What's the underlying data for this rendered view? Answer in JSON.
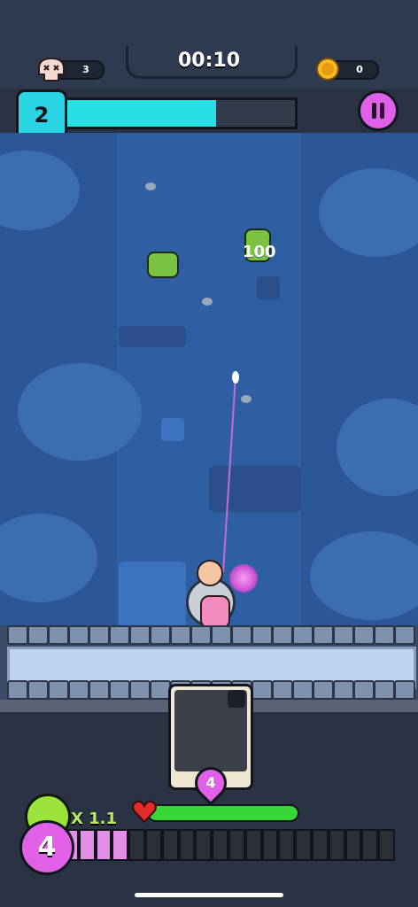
{
  "hud": {
    "kills": "3",
    "timer": "00:10",
    "coins": "0",
    "level": "2",
    "xp_progress": 0.66
  },
  "battle": {
    "damage_popup": "100"
  },
  "card": {
    "cost": "4"
  },
  "player": {
    "mana": "4",
    "multiplier": "X 1.1",
    "health_progress": 1.0,
    "mana_segments_filled": 4,
    "mana_segments_total": 20
  },
  "colors": {
    "xp_bar": "#27e0e6",
    "health_bar": "#36d637",
    "mana_fill": "#e58ee8",
    "level_badge": "#2ad4e4",
    "pause_button": "#e060e8"
  },
  "icons": {
    "kills": "skull-icon",
    "coins": "coin-icon",
    "pause": "pause-icon",
    "health": "heart-icon"
  }
}
